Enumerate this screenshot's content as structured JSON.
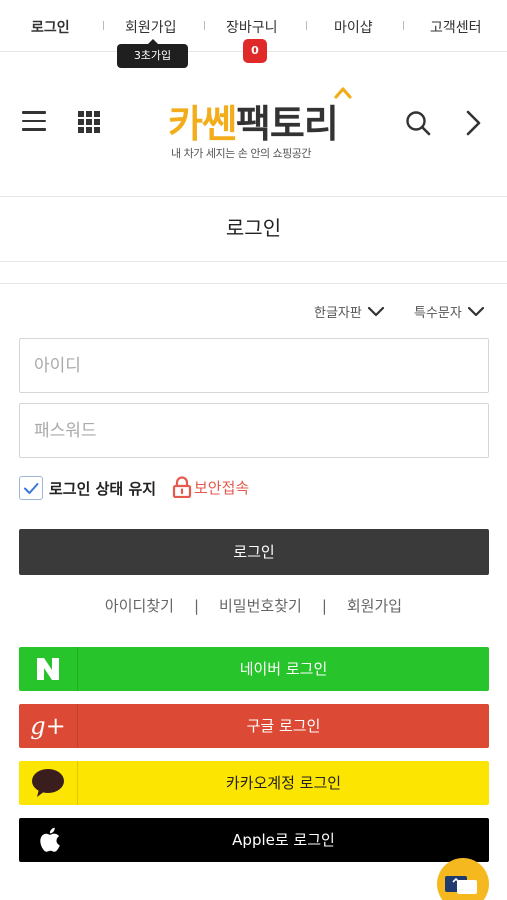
{
  "topnav": {
    "items": [
      "로그인",
      "회원가입",
      "장바구니",
      "마이샵",
      "고객센터"
    ],
    "join_badge": "3초가입",
    "cart_count": "0"
  },
  "header": {
    "logo_part1": "카쎈",
    "logo_part2": "팩토리",
    "slogan": "내 차가 세지는 손 안의 쇼핑공간"
  },
  "page_title": "로그인",
  "keyboard": {
    "korean": "한글자판",
    "special": "특수문자"
  },
  "form": {
    "id_placeholder": "아이디",
    "pw_placeholder": "패스워드",
    "keep_login": "로그인 상태 유지",
    "keep_checked": true,
    "secure": "보안접속",
    "login_button": "로그인"
  },
  "links": [
    "아이디찾기",
    "비밀번호찾기",
    "회원가입"
  ],
  "social": [
    {
      "label": "네이버 로그인",
      "color": "#27c42b"
    },
    {
      "label": "구글 로그인",
      "color": "#dc4a35"
    },
    {
      "label": "카카오계정 로그인",
      "color": "#fde502"
    },
    {
      "label": "Apple로 로그인",
      "color": "#000000"
    }
  ],
  "colors": {
    "brand_yellow": "#f2ad1b",
    "dark_button": "#3a3a3a",
    "badge_red": "#e02a2a"
  }
}
